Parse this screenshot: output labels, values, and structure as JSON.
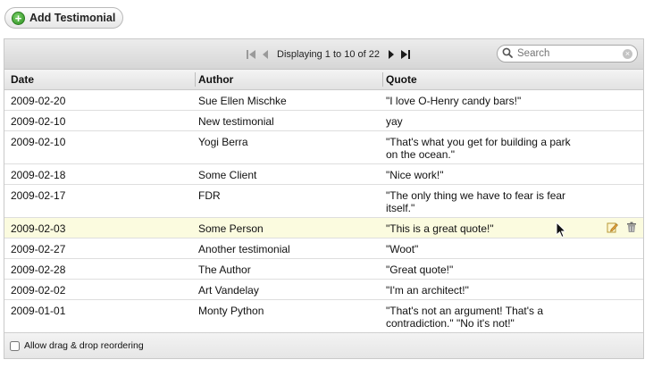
{
  "toolbar": {
    "add_button_label": "Add Testimonial",
    "pager_text": "Displaying 1 to 10 of 22",
    "search_placeholder": "Search"
  },
  "table": {
    "columns": [
      "Date",
      "Author",
      "Quote"
    ],
    "rows": [
      {
        "date": "2009-02-20",
        "author": "Sue Ellen Mischke",
        "quote": "\"I love O-Henry candy bars!\""
      },
      {
        "date": "2009-02-10",
        "author": "New testimonial",
        "quote": "yay"
      },
      {
        "date": "2009-02-10",
        "author": "Yogi Berra",
        "quote": "\"That's what you get for building a park on the ocean.\""
      },
      {
        "date": "2009-02-18",
        "author": "Some Client",
        "quote": "\"Nice work!\""
      },
      {
        "date": "2009-02-17",
        "author": "FDR",
        "quote": "\"The only thing we have to fear is fear itself.\""
      },
      {
        "date": "2009-02-03",
        "author": "Some Person",
        "quote": "\"This is a great quote!\""
      },
      {
        "date": "2009-02-27",
        "author": "Another testimonial",
        "quote": "\"Woot\""
      },
      {
        "date": "2009-02-28",
        "author": "The Author",
        "quote": "\"Great quote!\""
      },
      {
        "date": "2009-02-02",
        "author": "Art Vandelay",
        "quote": "\"I'm an architect!\""
      },
      {
        "date": "2009-01-01",
        "author": "Monty Python",
        "quote": "\"That's not an argument! That's a contradiction.\" \"No it's not!\""
      }
    ],
    "hovered_row_index": 5,
    "row_action_icons": [
      "edit-icon",
      "trash-icon"
    ]
  },
  "footer": {
    "drag_drop_label": "Allow drag & drop reordering",
    "drag_drop_checked": false
  },
  "colors": {
    "hover_row": "#fbfbdf",
    "add_icon": "#2c8f1f"
  }
}
